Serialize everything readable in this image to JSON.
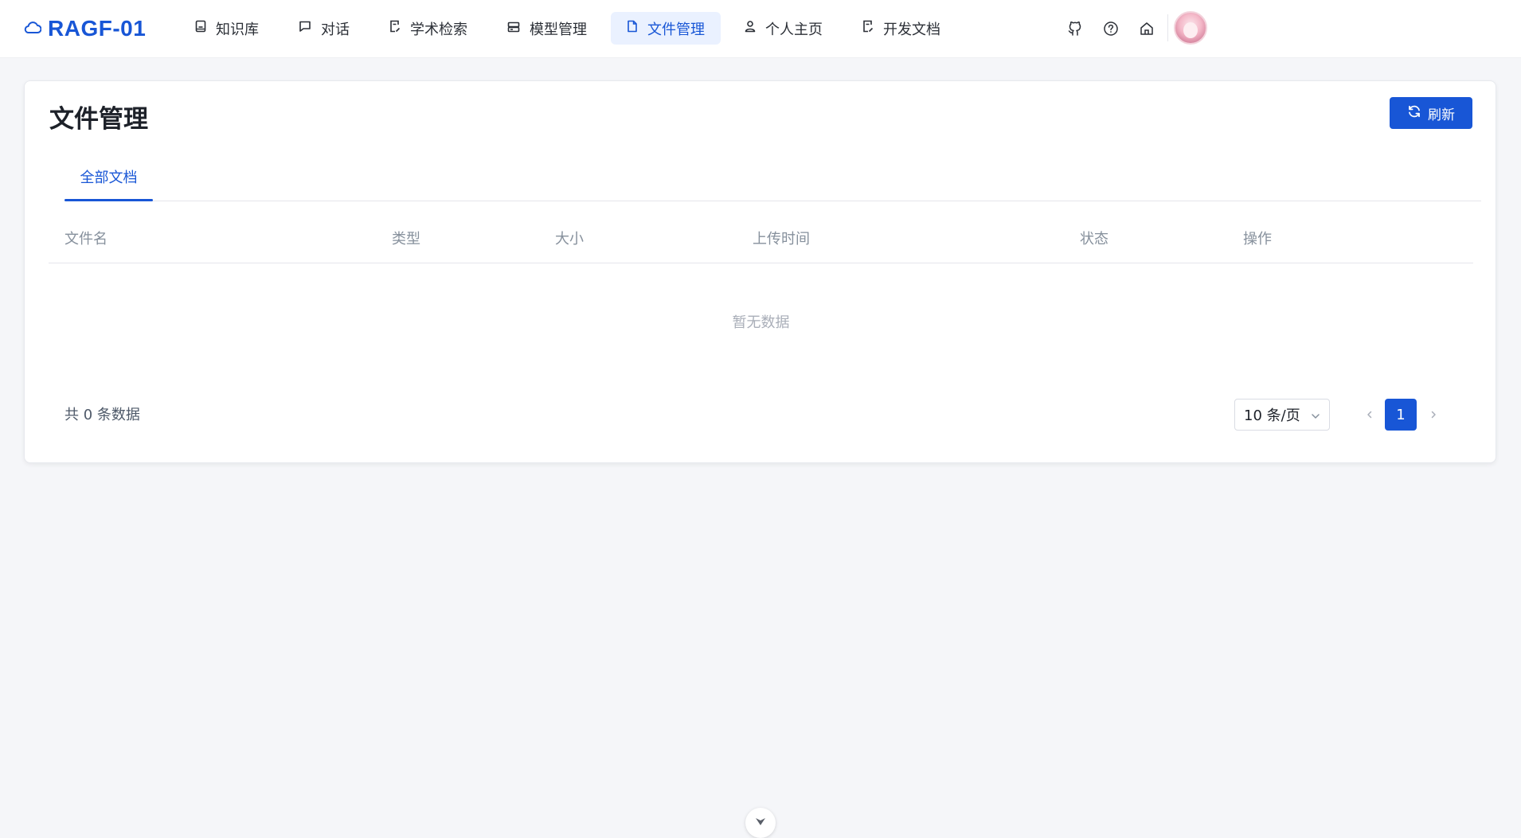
{
  "brand": {
    "name": "RAGF-01",
    "icon": "cloud-icon"
  },
  "nav": [
    {
      "label": "知识库",
      "icon": "book-icon",
      "active": false
    },
    {
      "label": "对话",
      "icon": "chat-icon",
      "active": false
    },
    {
      "label": "学术检索",
      "icon": "doc-edit-icon",
      "active": false
    },
    {
      "label": "模型管理",
      "icon": "server-icon",
      "active": false
    },
    {
      "label": "文件管理",
      "icon": "file-icon",
      "active": true
    },
    {
      "label": "个人主页",
      "icon": "user-icon",
      "active": false
    },
    {
      "label": "开发文档",
      "icon": "doc-edit-icon",
      "active": false
    }
  ],
  "header_icons": [
    "github-icon",
    "help-icon",
    "home-icon"
  ],
  "page": {
    "title": "文件管理",
    "refresh_label": "刷新"
  },
  "tabs": [
    {
      "label": "全部文档",
      "active": true
    }
  ],
  "table": {
    "columns": [
      "文件名",
      "类型",
      "大小",
      "上传时间",
      "状态",
      "操作"
    ],
    "rows": [],
    "empty_text": "暂无数据"
  },
  "pagination": {
    "total_text": "共 0 条数据",
    "page_size": "10 条/页",
    "current_page": "1"
  },
  "colors": {
    "accent": "#1856d6",
    "background": "#f5f6f9"
  }
}
